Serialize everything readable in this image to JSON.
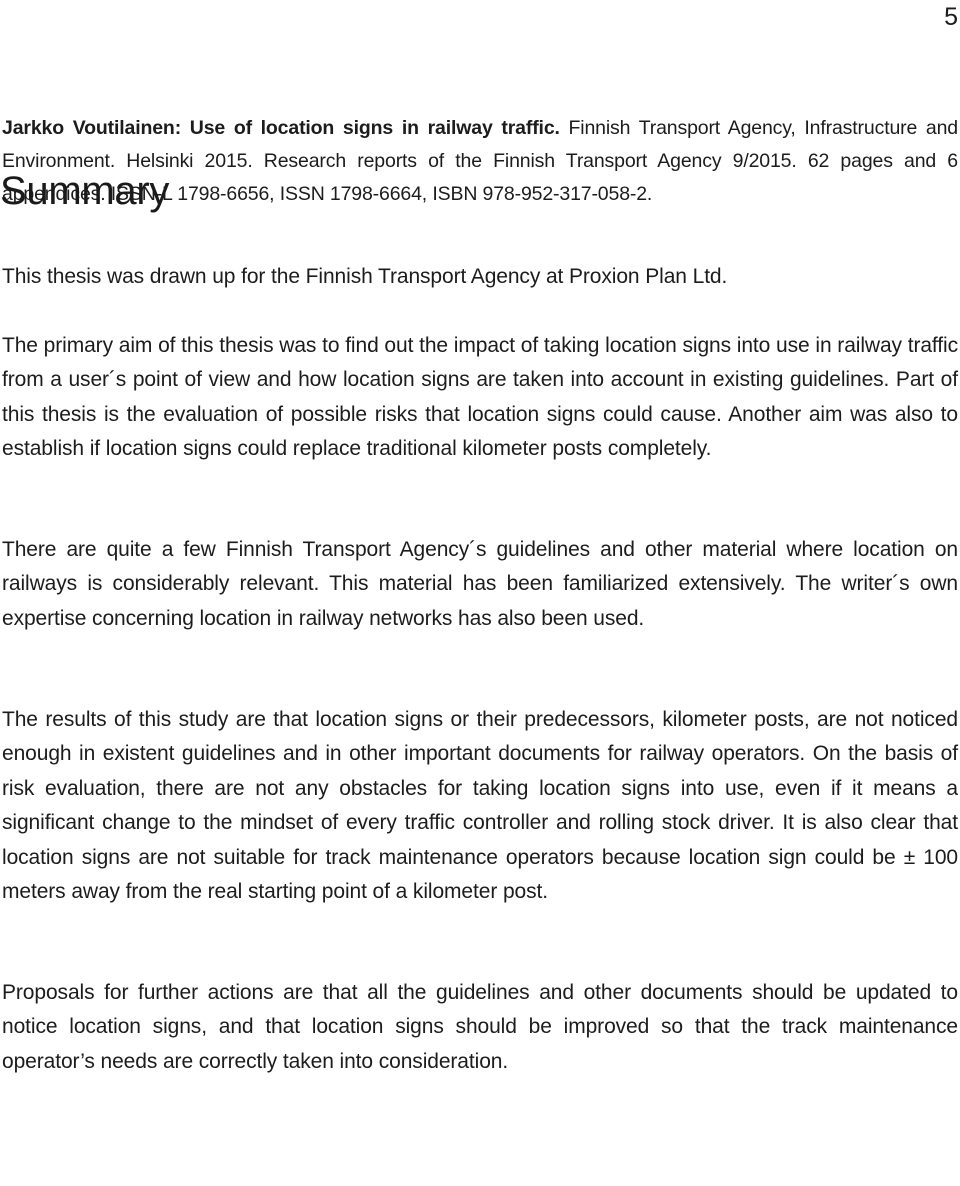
{
  "page": {
    "number": "5"
  },
  "biblio": {
    "bold_part": "Jarkko Voutilainen: Use of location signs in railway traffic.",
    "rest": " Finnish Transport Agency, Infrastructure and Environment. Helsinki 2015. Research reports of the Finnish Transport Agency 9/2015. 62 pages and 6 appendices. ISSN-L 1798-6656, ISSN 1798-6664, ISBN 978-952-317-058-2."
  },
  "heading": {
    "summary": "Summary"
  },
  "paragraphs": {
    "intro": "This thesis was drawn up for the Finnish Transport Agency at Proxion Plan Ltd.",
    "aim": "The primary aim of this thesis was to find out the impact of taking location signs into use in railway traffic from a user´s point of view and how location signs are taken into account in existing guidelines. Part of this thesis is the evaluation of possible risks that location signs could cause. Another aim was also to establish if location signs could replace traditional kilometer posts completely.",
    "guidelines": "There are quite a few Finnish Transport Agency´s guidelines and other material where location on railways is considerably relevant. This material has been familiarized extensively. The writer´s own expertise concerning location in railway networks has also been used.",
    "results": "The results of this study are that location signs or their predecessors, kilometer posts, are not noticed enough in existent guidelines and in other important documents for railway operators. On the basis of risk evaluation, there are not any obstacles for taking location signs into use, even if it means a significant change to the mindset of every traffic controller and rolling stock driver. It is also clear that location signs are not suitable for track maintenance operators because location sign could be ± 100 meters away from the real starting point of a kilometer post.",
    "proposals": "Proposals for further actions are that all the guidelines and other documents should be updated to notice location signs, and that location signs should be improved so that the track maintenance operator’s needs are correctly taken into consideration."
  }
}
